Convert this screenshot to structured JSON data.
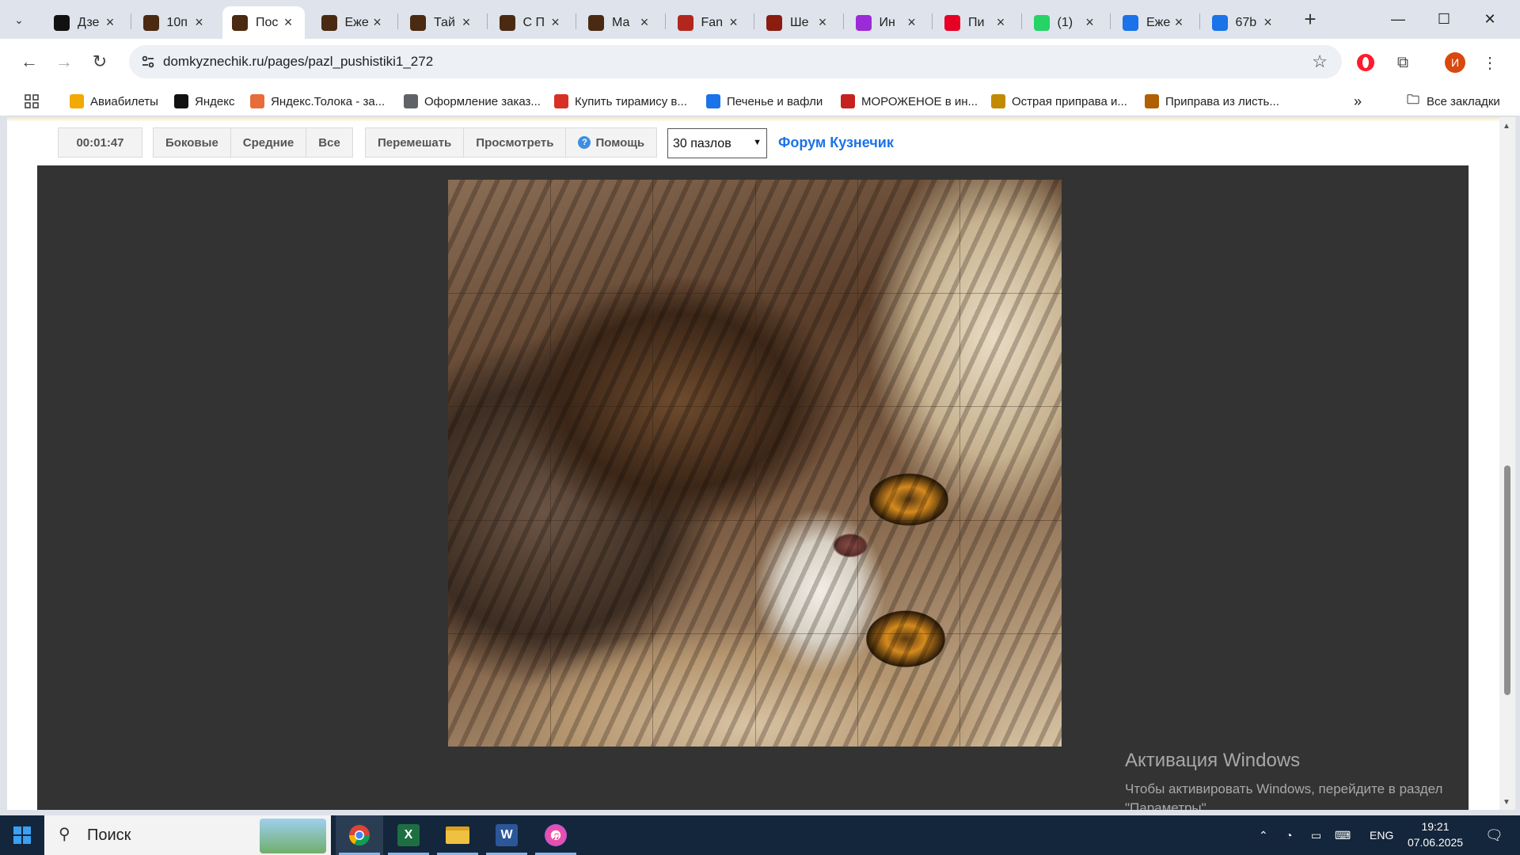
{
  "browser": {
    "tabs": [
      {
        "title": "Дзе",
        "favicon": "dzen-icon",
        "color": "#111111"
      },
      {
        "title": "10п",
        "favicon": "puzzle-favicon",
        "color": "#4a2a12"
      },
      {
        "title": "Пос",
        "favicon": "puzzle-favicon",
        "color": "#4a2a12"
      },
      {
        "title": "Еже",
        "favicon": "puzzle-favicon",
        "color": "#4a2a12"
      },
      {
        "title": "Тай",
        "favicon": "puzzle-favicon",
        "color": "#4a2a12"
      },
      {
        "title": "С П",
        "favicon": "puzzle-favicon",
        "color": "#4a2a12"
      },
      {
        "title": "Ма",
        "favicon": "puzzle-favicon",
        "color": "#4a2a12"
      },
      {
        "title": "Fan",
        "favicon": "fan-icon",
        "color": "#b3261e"
      },
      {
        "title": "Ше",
        "favicon": "she-icon",
        "color": "#8a1c10"
      },
      {
        "title": "Ин",
        "favicon": "wb-icon",
        "color": "#9b2bd6"
      },
      {
        "title": "Пи",
        "favicon": "pinterest-icon",
        "color": "#e60023"
      },
      {
        "title": "(1)",
        "favicon": "whatsapp-icon",
        "color": "#25d366"
      },
      {
        "title": "Еже",
        "favicon": "doc-icon",
        "color": "#1a73e8"
      },
      {
        "title": "67b",
        "favicon": "doc-icon",
        "color": "#1a73e8"
      }
    ],
    "active_tab_index": 2,
    "url": "domkyznechik.ru/pages/pazl_pushistiki1_272",
    "profile_initial": "И",
    "bookmarks": [
      {
        "label": "Авиабилеты",
        "icon": "avia-icon",
        "color": "#f2a900"
      },
      {
        "label": "Яндекс",
        "icon": "yandex-icon",
        "color": "#111111"
      },
      {
        "label": "Яндекс.Толока - за...",
        "icon": "toloka-icon",
        "color": "#e86c3a"
      },
      {
        "label": "Оформление заказ...",
        "icon": "globe-icon",
        "color": "#5f6368"
      },
      {
        "label": "Купить тирамису в...",
        "icon": "cake-icon",
        "color": "#d93025"
      },
      {
        "label": "Печенье и вафли",
        "icon": "basket-icon",
        "color": "#1a73e8"
      },
      {
        "label": "МОРОЖЕНОЕ в ин...",
        "icon": "d-icon",
        "color": "#c5221f"
      },
      {
        "label": "Острая приправа и...",
        "icon": "spice-icon",
        "color": "#c28a00"
      },
      {
        "label": "Приправа из листь...",
        "icon": "ж-icon",
        "color": "#b06000"
      }
    ],
    "all_bookmarks_label": "Все закладки"
  },
  "puzzle_page": {
    "timer": "00:01:47",
    "filter_buttons": [
      "Боковые",
      "Средние",
      "Все"
    ],
    "action_buttons": [
      "Перемешать",
      "Просмотреть",
      "Помощь"
    ],
    "pieces_select": "30 пазлов",
    "forum_link": "Форум Кузнечик",
    "grid_cols": 6,
    "grid_rows": 5
  },
  "watermark": {
    "title": "Активация Windows",
    "subtitle": "Чтобы активировать Windows, перейдите в раздел \"Параметры\"."
  },
  "taskbar": {
    "search_label": "Поиск",
    "apps": [
      "chrome-icon",
      "excel-icon",
      "explorer-icon",
      "word-icon",
      "itunes-icon"
    ],
    "language": "ENG",
    "time": "19:21",
    "date": "07.06.2025"
  }
}
